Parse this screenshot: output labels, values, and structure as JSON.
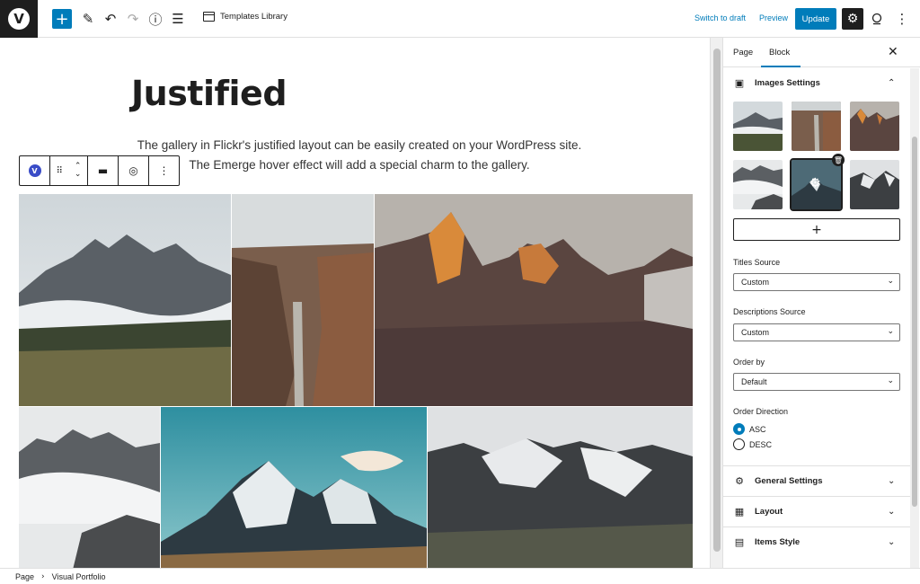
{
  "topbar": {
    "logo_letter": "V",
    "add_icon": "plus-icon",
    "templates_library": "Templates Library",
    "switch_to_draft": "Switch to draft",
    "preview": "Preview",
    "update": "Update"
  },
  "editor": {
    "title": "Justified",
    "description": "The gallery in Flickr's justified layout can be easily created on your WordPress site. The Emerge hover effect will add a special charm to the gallery.",
    "toolbar_logo": "V"
  },
  "sidebar": {
    "tabs": [
      "Page",
      "Block"
    ],
    "active_tab": "Block",
    "images_settings": "Images Settings",
    "titles_source_label": "Titles Source",
    "titles_source_value": "Custom",
    "descriptions_source_label": "Descriptions Source",
    "descriptions_source_value": "Custom",
    "order_by_label": "Order by",
    "order_by_value": "Default",
    "order_direction_label": "Order Direction",
    "order_direction_options": [
      "ASC",
      "DESC"
    ],
    "order_direction_selected": "ASC",
    "sections": [
      "General Settings",
      "Layout",
      "Items Style"
    ]
  },
  "footer": {
    "breadcrumb": [
      "Page",
      "Visual Portfolio"
    ]
  },
  "colors": {
    "accent": "#007cba",
    "dark": "#1e1e1e"
  }
}
